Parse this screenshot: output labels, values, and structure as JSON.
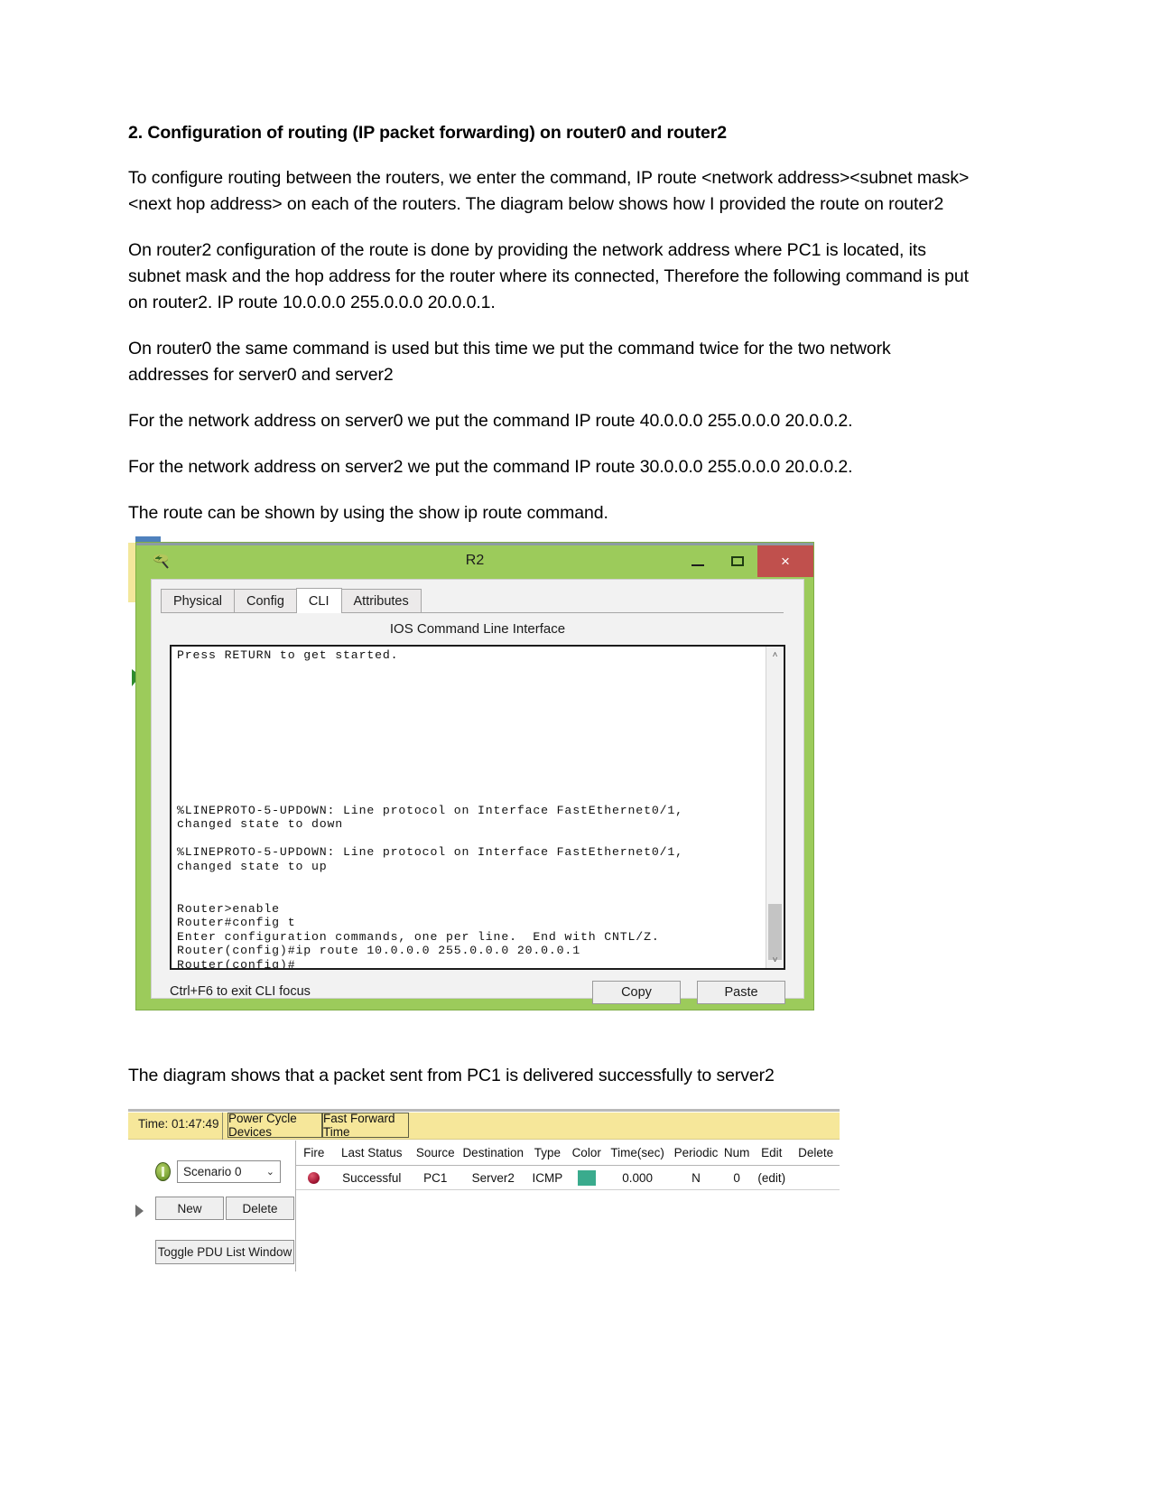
{
  "document": {
    "heading": "2. Configuration of routing (IP packet forwarding) on router0 and router2",
    "paragraphs": [
      "To configure routing between the routers, we enter the command, IP route <network address><subnet mask><next hop address> on each of the routers. The diagram below shows how I provided the route on router2",
      "On router2 configuration of the route is done by providing the network address where PC1 is located, its subnet mask and the hop address for the router where its connected, Therefore the following command is put on router2. IP route 10.0.0.0 255.0.0.0 20.0.0.1.",
      "On router0 the same command is used but this time we put the command twice for the two network addresses for server0 and server2",
      "For the network address on server0 we put the command IP route 40.0.0.0 255.0.0.0 20.0.0.2.",
      "For the network address on server2 we put the command IP route 30.0.0.0 255.0.0.0 20.0.0.2.",
      "The route can be shown by using the show ip route command."
    ],
    "caption2": "The diagram shows that a packet sent from PC1 is delivered successfully to server2"
  },
  "cli_window": {
    "title": "R2",
    "app_icon": "packet-tracer-router-icon",
    "window_buttons": {
      "minimize": "minimize-icon",
      "maximize": "maximize-icon",
      "close": "×"
    },
    "tabs": [
      {
        "label": "Physical",
        "active": false
      },
      {
        "label": "Config",
        "active": false
      },
      {
        "label": "CLI",
        "active": true
      },
      {
        "label": "Attributes",
        "active": false
      }
    ],
    "section_title": "IOS Command Line Interface",
    "terminal_text": "Press RETURN to get started.\n\n\n\n\n\n\n\n\n\n\n%LINEPROTO-5-UPDOWN: Line protocol on Interface FastEthernet0/1,\nchanged state to down\n\n%LINEPROTO-5-UPDOWN: Line protocol on Interface FastEthernet0/1,\nchanged state to up\n\n\nRouter>enable\nRouter#config t\nEnter configuration commands, one per line.  End with CNTL/Z.\nRouter(config)#ip route 10.0.0.0 255.0.0.0 20.0.0.1\nRouter(config)#",
    "focus_hint": "Ctrl+F6 to exit CLI focus",
    "copy_label": "Copy",
    "paste_label": "Paste",
    "scroll_up_glyph": "˄",
    "scroll_down_glyph": "˅",
    "titlebar_color": "#9ccb5b",
    "close_color": "#c0504d"
  },
  "simulation_panel": {
    "time_label": "Time: 01:47:49",
    "power_cycle_label": "Power Cycle Devices",
    "fast_forward_label": "Fast Forward Time",
    "scenario_value": "Scenario 0",
    "scenario_chevron": "⌄",
    "new_label": "New",
    "delete_label": "Delete",
    "toggle_label": "Toggle PDU List Window",
    "toolbar_color": "#f6e79a",
    "pdu_table": {
      "columns": [
        "Fire",
        "Last Status",
        "Source",
        "Destination",
        "Type",
        "Color",
        "Time(sec)",
        "Periodic",
        "Num",
        "Edit",
        "Delete"
      ],
      "rows": [
        {
          "fire": "fire-dot-icon",
          "last_status": "Successful",
          "source": "PC1",
          "destination": "Server2",
          "type": "ICMP",
          "color": "#3aab8d",
          "time_sec": "0.000",
          "periodic": "N",
          "num": "0",
          "edit": "(edit)",
          "delete": ""
        }
      ]
    }
  }
}
